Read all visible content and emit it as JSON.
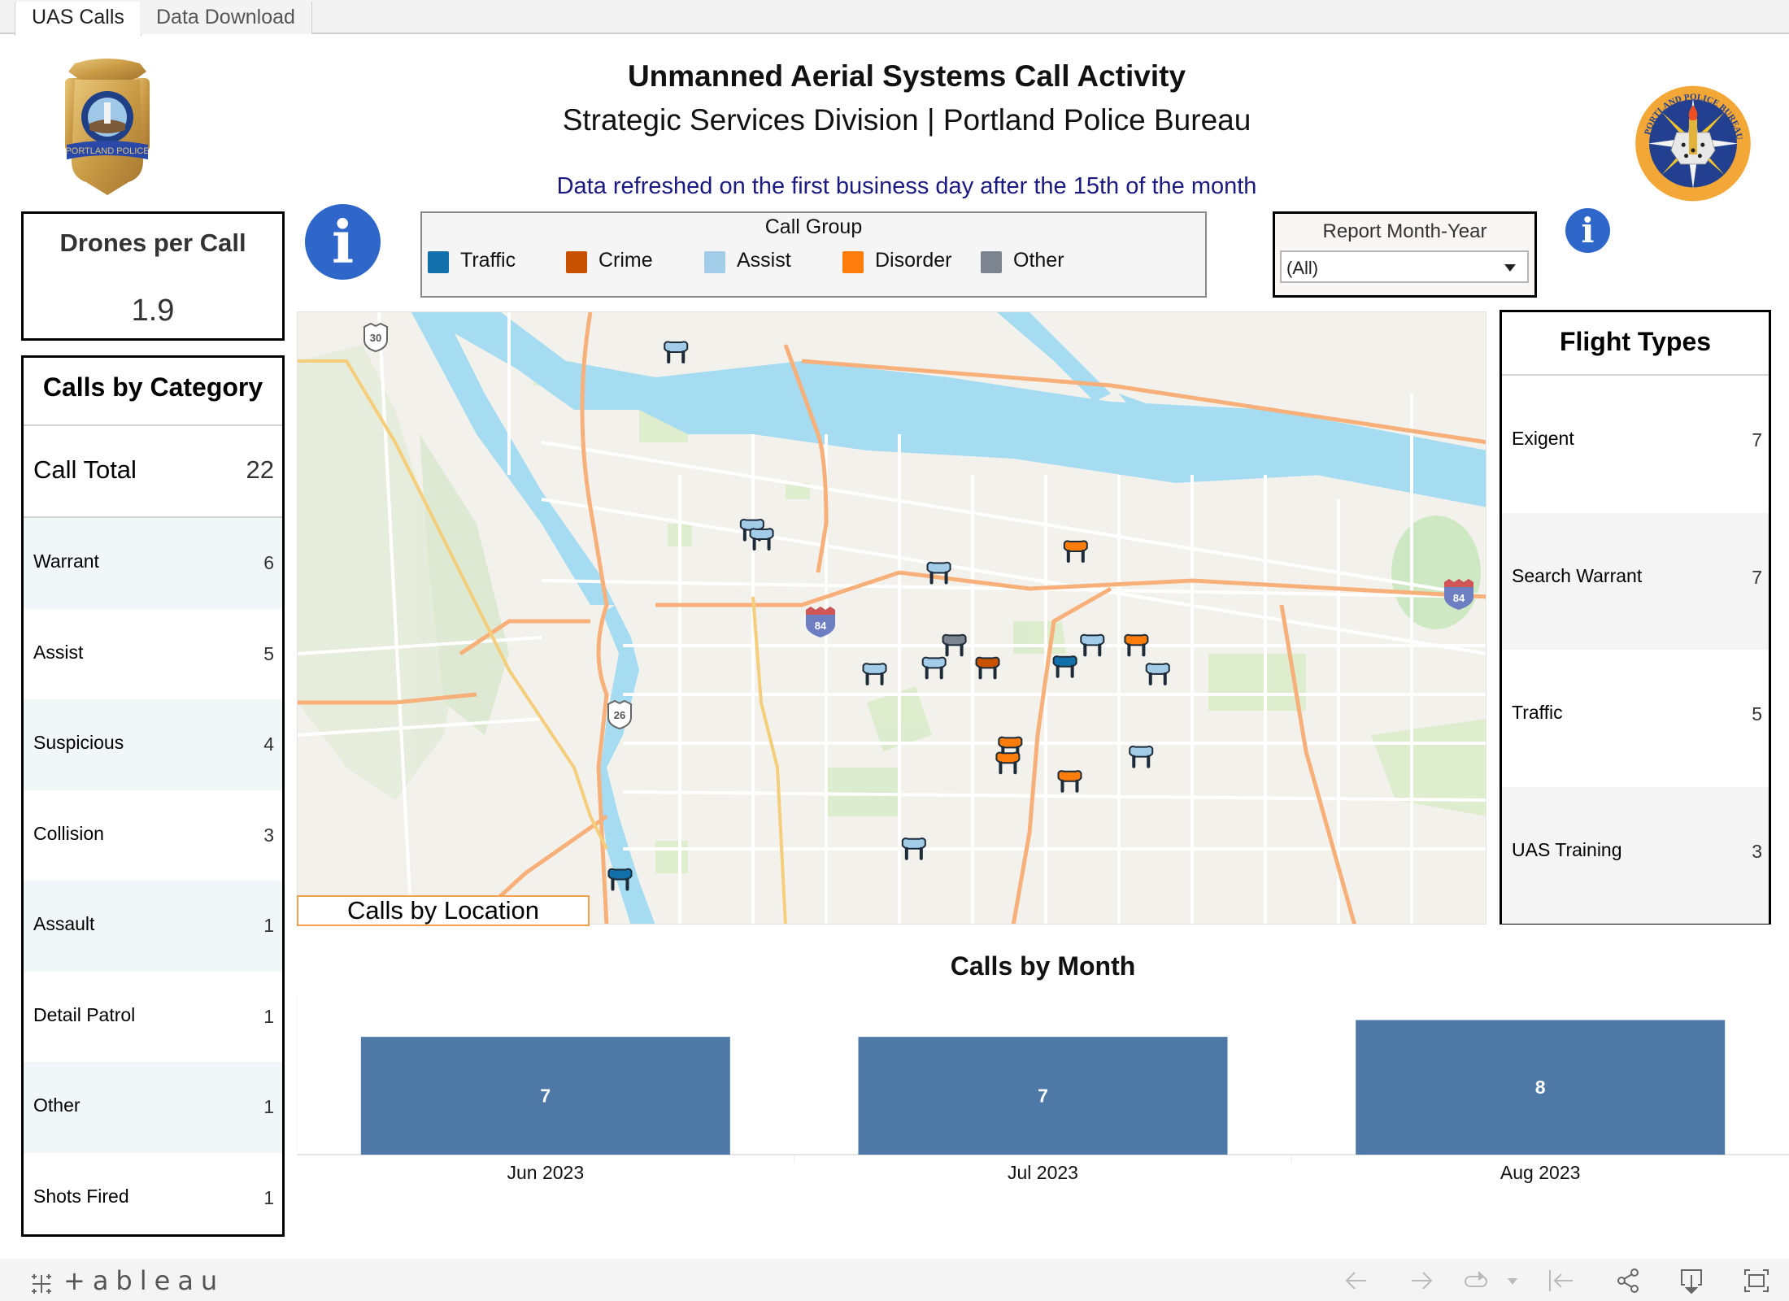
{
  "tabs": [
    {
      "label": "UAS Calls",
      "active": true
    },
    {
      "label": "Data Download",
      "active": false
    }
  ],
  "header": {
    "title": "Unmanned Aerial Systems Call Activity",
    "subtitle": "Strategic Services Division | Portland Police Bureau",
    "refresh_note": "Data refreshed on the first business day after the 15th of the month",
    "left_logo": "portland-police-badge",
    "right_logo": "strategic-services-division-seal",
    "left_logo_text": "PORTLAND POLICE",
    "right_logo_text": "PORTLAND POLICE BUREAU · STRATEGIC SERVICES DIVISION"
  },
  "drones_per_call": {
    "title": "Drones per Call",
    "value": "1.9"
  },
  "calls_by_category": {
    "title": "Calls by Category",
    "total_label": "Call Total",
    "total_value": "22",
    "rows": [
      {
        "label": "Warrant",
        "value": "6"
      },
      {
        "label": "Assist",
        "value": "5"
      },
      {
        "label": "Suspicious",
        "value": "4"
      },
      {
        "label": "Collision",
        "value": "3"
      },
      {
        "label": "Assault",
        "value": "1"
      },
      {
        "label": "Detail Patrol",
        "value": "1"
      },
      {
        "label": "Other",
        "value": "1"
      },
      {
        "label": "Shots Fired",
        "value": "1"
      }
    ]
  },
  "info_icons": {
    "left": "info-icon",
    "right": "info-icon",
    "glyph": "i"
  },
  "legend": {
    "title": "Call Group",
    "items": [
      {
        "label": "Traffic",
        "color": "#1170aa"
      },
      {
        "label": "Crime",
        "color": "#c85200"
      },
      {
        "label": "Assist",
        "color": "#a3cce9"
      },
      {
        "label": "Disorder",
        "color": "#fc7d0b"
      },
      {
        "label": "Other",
        "color": "#7b848f"
      }
    ]
  },
  "report_filter": {
    "title": "Report Month-Year",
    "selected": "(All)"
  },
  "map": {
    "label": "Calls by Location",
    "highway_shields": [
      {
        "type": "us",
        "number": "30"
      },
      {
        "type": "interstate",
        "number": "84"
      },
      {
        "type": "us",
        "number": "26"
      },
      {
        "type": "interstate",
        "number": "84"
      }
    ],
    "markers": [
      {
        "group": "Assist",
        "lon_frac": 0.318,
        "lat_frac": 0.065
      },
      {
        "group": "Assist",
        "lon_frac": 0.382,
        "lat_frac": 0.355
      },
      {
        "group": "Assist",
        "lon_frac": 0.39,
        "lat_frac": 0.37
      },
      {
        "group": "Assist",
        "lon_frac": 0.539,
        "lat_frac": 0.425
      },
      {
        "group": "Disorder",
        "lon_frac": 0.654,
        "lat_frac": 0.39
      },
      {
        "group": "Other",
        "lon_frac": 0.552,
        "lat_frac": 0.543
      },
      {
        "group": "Assist",
        "lon_frac": 0.485,
        "lat_frac": 0.59
      },
      {
        "group": "Assist",
        "lon_frac": 0.535,
        "lat_frac": 0.58
      },
      {
        "group": "Crime",
        "lon_frac": 0.58,
        "lat_frac": 0.58
      },
      {
        "group": "Traffic",
        "lon_frac": 0.645,
        "lat_frac": 0.578
      },
      {
        "group": "Assist",
        "lon_frac": 0.668,
        "lat_frac": 0.543
      },
      {
        "group": "Disorder",
        "lon_frac": 0.705,
        "lat_frac": 0.543
      },
      {
        "group": "Assist",
        "lon_frac": 0.723,
        "lat_frac": 0.59
      },
      {
        "group": "Disorder",
        "lon_frac": 0.599,
        "lat_frac": 0.71
      },
      {
        "group": "Disorder",
        "lon_frac": 0.597,
        "lat_frac": 0.735
      },
      {
        "group": "Disorder",
        "lon_frac": 0.649,
        "lat_frac": 0.765
      },
      {
        "group": "Assist",
        "lon_frac": 0.709,
        "lat_frac": 0.725
      },
      {
        "group": "Assist",
        "lon_frac": 0.518,
        "lat_frac": 0.875
      },
      {
        "group": "Traffic",
        "lon_frac": 0.271,
        "lat_frac": 0.925
      }
    ]
  },
  "flight_types": {
    "title": "Flight Types",
    "rows": [
      {
        "label": "Exigent",
        "value": "7"
      },
      {
        "label": "Search Warrant",
        "value": "7"
      },
      {
        "label": "Traffic",
        "value": "5"
      },
      {
        "label": "UAS Training",
        "value": "3"
      }
    ]
  },
  "chart_data": {
    "type": "bar",
    "title": "Calls by Month",
    "categories": [
      "Jun 2023",
      "Jul 2023",
      "Aug 2023"
    ],
    "values": [
      7,
      7,
      8
    ],
    "data_labels": [
      "7",
      "7",
      "8"
    ],
    "xlabel": "",
    "ylabel": "",
    "ylim": [
      0,
      8.7
    ],
    "bar_color": "#4e79a7",
    "grid": false,
    "legend": "none"
  },
  "toolbar": {
    "brand": "+ableau",
    "buttons": [
      {
        "name": "undo",
        "icon": "arrow-left-icon",
        "enabled": false
      },
      {
        "name": "redo",
        "icon": "arrow-right-icon",
        "enabled": false
      },
      {
        "name": "revert",
        "icon": "revert-icon",
        "enabled": false
      },
      {
        "name": "revert-menu",
        "icon": "caret-down-icon",
        "enabled": false
      },
      {
        "name": "reset",
        "icon": "reset-to-start-icon",
        "enabled": false
      },
      {
        "name": "share",
        "icon": "share-icon",
        "enabled": true
      },
      {
        "name": "download",
        "icon": "download-icon",
        "enabled": true
      },
      {
        "name": "fullscreen",
        "icon": "fullscreen-icon",
        "enabled": true
      }
    ]
  }
}
